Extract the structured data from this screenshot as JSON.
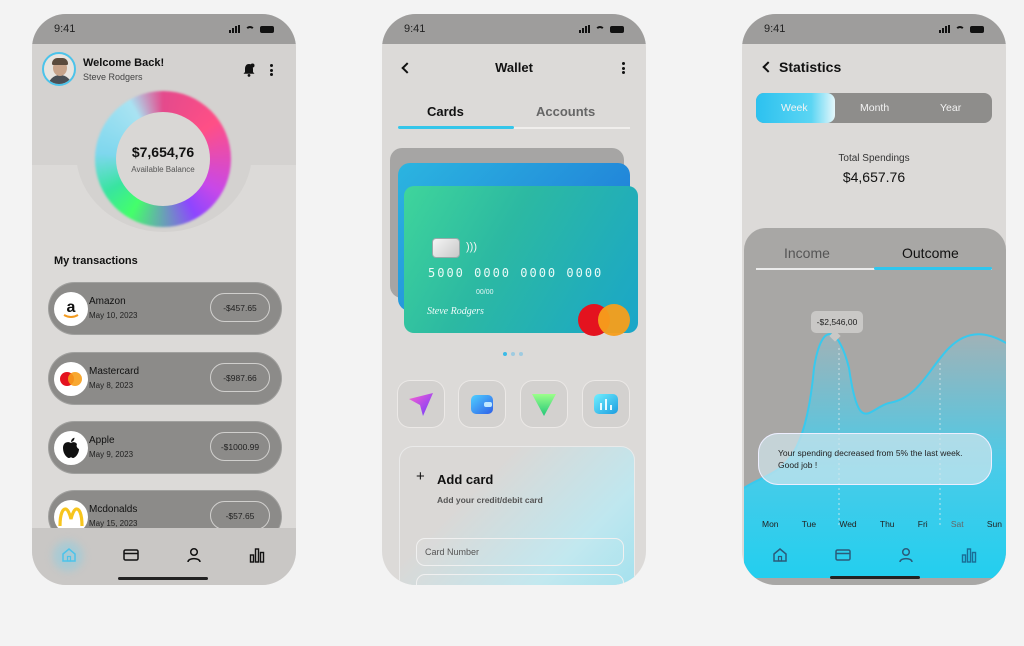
{
  "status": {
    "time": "9:41"
  },
  "home": {
    "welcome": "Welcome Back!",
    "user_name": "Steve Rodgers",
    "balance": "$7,654,76",
    "balance_label": "Available Balance",
    "transactions_title": "My transactions",
    "transactions": [
      {
        "name": "Amazon",
        "date": "May 10, 2023",
        "amount": "-$457.65",
        "logo": "amazon-logo"
      },
      {
        "name": "Mastercard",
        "date": "May 8, 2023",
        "amount": "-$987.66",
        "logo": "mastercard-logo"
      },
      {
        "name": "Apple",
        "date": "May 9, 2023",
        "amount": "-$1000.99",
        "logo": "apple-logo"
      },
      {
        "name": "Mcdonalds",
        "date": "May 15, 2023",
        "amount": "-$57.65",
        "logo": "mcdonalds-logo"
      }
    ],
    "nav": [
      "home-icon",
      "card-icon",
      "user-icon",
      "chart-icon"
    ]
  },
  "wallet": {
    "title": "Wallet",
    "tabs": [
      "Cards",
      "Accounts"
    ],
    "active_tab": "Cards",
    "card": {
      "number": "5000  0000  0000  0000",
      "expiry": "00/00",
      "holder": "Steve Rodgers"
    },
    "add_card": {
      "title": "Add card",
      "subtitle": "Add your credit/debit card"
    },
    "card_number_placeholder": "Card Number",
    "quick_actions": [
      "send-icon",
      "wallet-icon",
      "receive-icon",
      "stats-icon"
    ]
  },
  "stats": {
    "title": "Statistics",
    "periods": [
      "Week",
      "Month",
      "Year"
    ],
    "active_period": "Week",
    "total_label": "Total Spendings",
    "total_value": "$4,657.76",
    "tabs": [
      "Income",
      "Outcome"
    ],
    "active_tab": "Outcome",
    "tooltip": "-$2,546,00",
    "message": "Your spending decreased from 5% the last week. Good job !",
    "days": [
      "Mon",
      "Tue",
      "Wed",
      "Thu",
      "Fri",
      "Sat",
      "Sun"
    ]
  },
  "colors": {
    "accent": "#34c6ea",
    "panel": "#a8a7a5"
  }
}
